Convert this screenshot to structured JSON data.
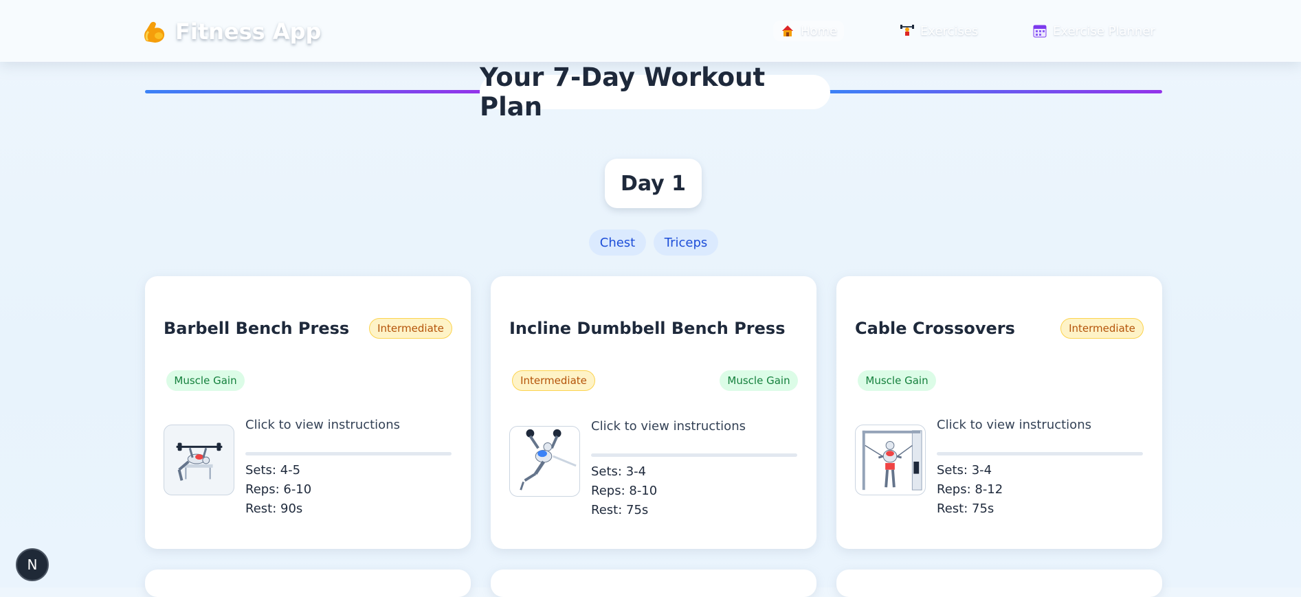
{
  "brand": {
    "title": "Fitness App",
    "icon": "flexed-biceps-icon"
  },
  "nav": [
    {
      "label": "Home",
      "icon": "house-icon"
    },
    {
      "label": "Exercises",
      "icon": "weightlifter-icon"
    },
    {
      "label": "Exercise Planner",
      "icon": "calendar-icon"
    }
  ],
  "plan": {
    "title": "Your 7-Day Workout Plan"
  },
  "day": {
    "label": "Day 1",
    "muscles": [
      "Chest",
      "Triceps"
    ]
  },
  "exercises": [
    {
      "name": "Barbell Bench Press",
      "level": "Intermediate",
      "goal": "Muscle Gain",
      "instructions": "Click to view instructions",
      "sets": "Sets: 4-5",
      "reps": "Reps: 6-10",
      "rest": "Rest: 90s"
    },
    {
      "name": "Incline Dumbbell Bench Press",
      "level": "Intermediate",
      "goal": "Muscle Gain",
      "instructions": "Click to view instructions",
      "sets": "Sets: 3-4",
      "reps": "Reps: 8-10",
      "rest": "Rest: 75s"
    },
    {
      "name": "Cable Crossovers",
      "level": "Intermediate",
      "goal": "Muscle Gain",
      "instructions": "Click to view instructions",
      "sets": "Sets: 3-4",
      "reps": "Reps: 8-12",
      "rest": "Rest: 75s"
    }
  ],
  "colors": {
    "accent_blue": "#3b82f6",
    "accent_purple": "#9333ea",
    "level_bg": "#fef3c7",
    "goal_bg": "#dcfce7"
  },
  "dev_badge": {
    "label": "N"
  }
}
